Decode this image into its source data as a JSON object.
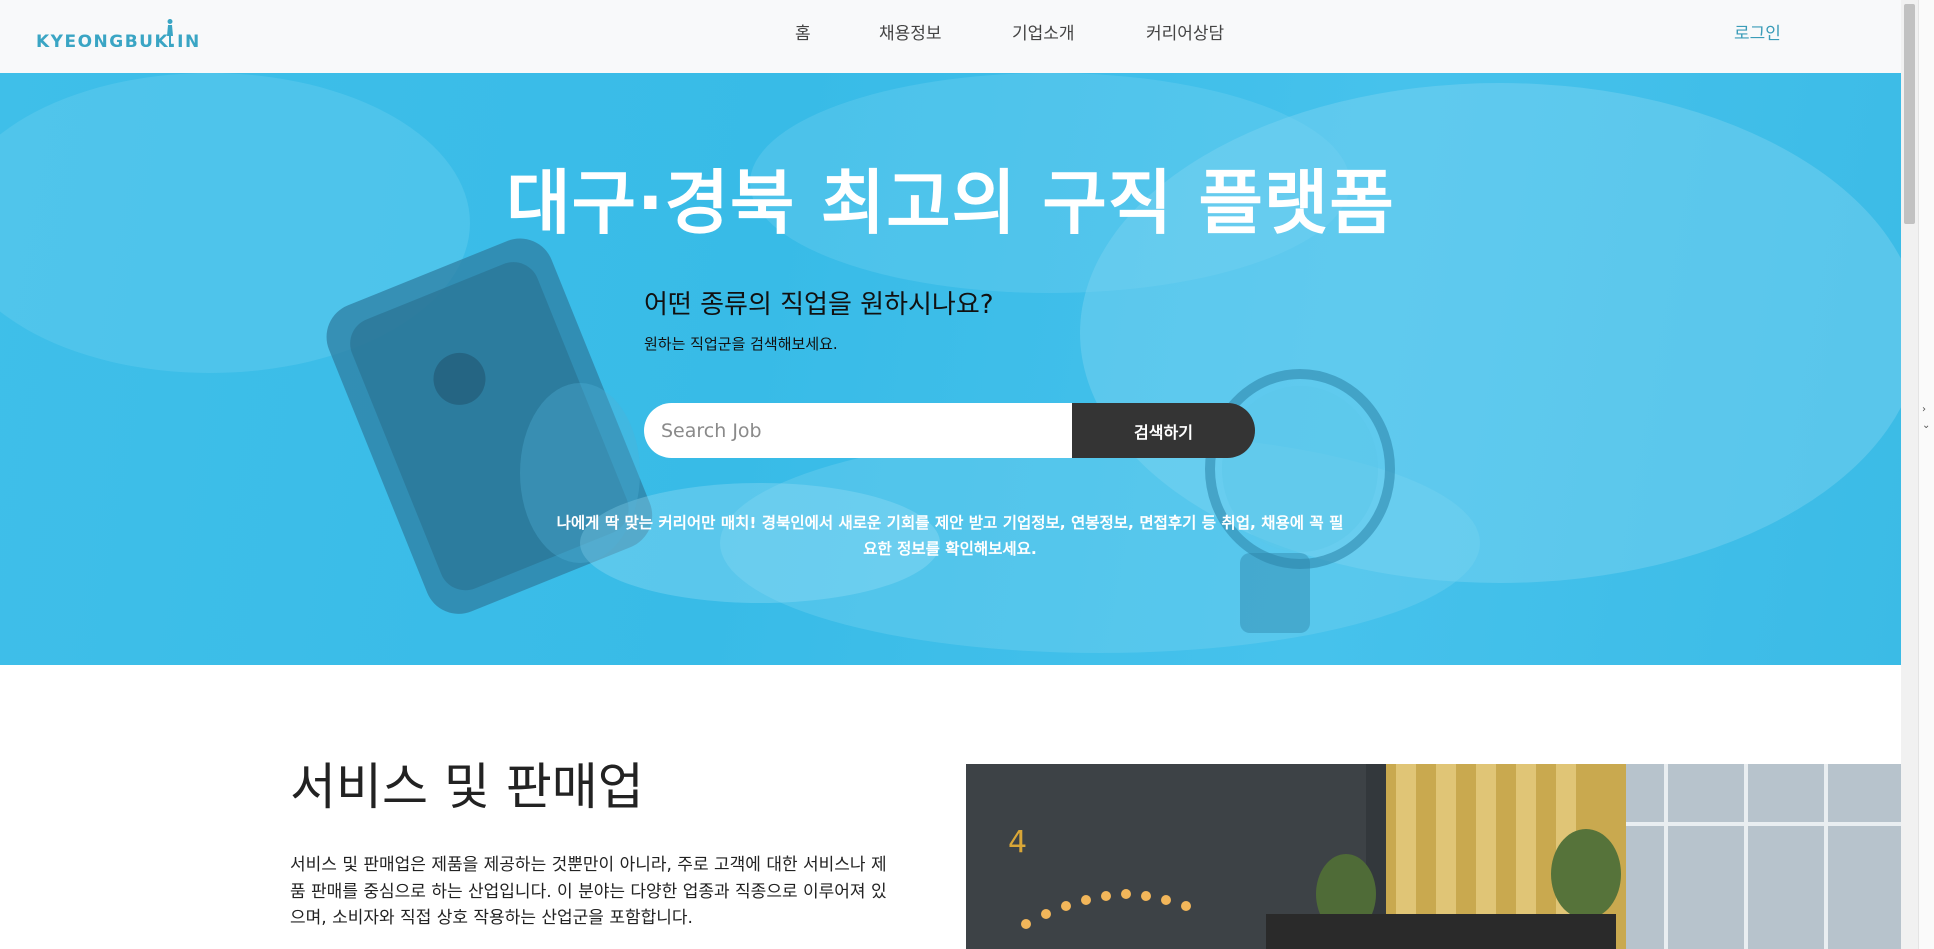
{
  "header": {
    "logo_text": "KYEONGBUK.IN",
    "nav": [
      "홈",
      "채용정보",
      "기업소개",
      "커리어상담"
    ],
    "login_label": "로그인"
  },
  "hero": {
    "title": "대구·경북 최고의 구직 플랫폼",
    "question": "어떤 종류의 직업을 원하시나요?",
    "hint": "원하는 직업군을 검색해보세요.",
    "search_placeholder": "Search Job",
    "search_button": "검색하기",
    "description_line1": "나에게 딱 맞는 커리어만 매치! 경북인에서 새로운 기회를 제안 받고 기업정보, 연봉정보, 면접후기 등 취업, 채용에 꼭 필",
    "description_line2": "요한 정보를 확인해보세요."
  },
  "section": {
    "title": "서비스 및 판매업",
    "body_line1": "서비스 및 판매업은 제품을 제공하는 것뿐만이 아니라, 주로 고객에 대한 서비스나 제",
    "body_line2": "품 판매를 중심으로 하는 산업입니다. 이 분야는 다양한 업종과 직종으로 이루어져 있",
    "body_line3": "으며, 소비자와 직접 상호 작용하는 산업군을 포함합니다."
  },
  "colors": {
    "hero_blue": "#3fbfe9",
    "logo": "#3aa5c4",
    "login": "#3a9cb8",
    "search_button": "#343434"
  },
  "icons": [
    "logo-figure-icon",
    "chevron-right-icon",
    "chevron-down-icon"
  ]
}
